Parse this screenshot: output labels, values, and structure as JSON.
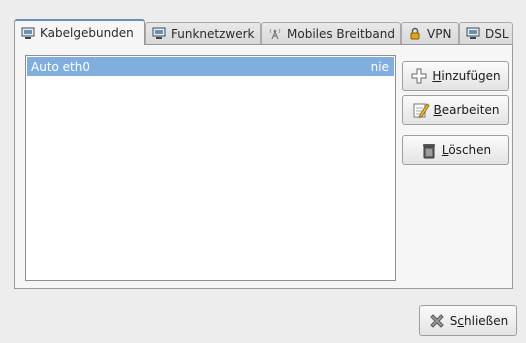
{
  "tabs": [
    {
      "label": "Kabelgebunden",
      "icon": "network-wired-icon",
      "active": true
    },
    {
      "label": "Funknetzwerk",
      "icon": "network-wireless-icon",
      "active": false
    },
    {
      "label": "Mobiles Breitband",
      "icon": "antenna-icon",
      "active": false
    },
    {
      "label": "VPN",
      "icon": "lock-icon",
      "active": false
    },
    {
      "label": "DSL",
      "icon": "network-dsl-icon",
      "active": false
    }
  ],
  "connections": [
    {
      "name": "Auto eth0",
      "last_used": "nie",
      "selected": true
    }
  ],
  "buttons": {
    "add": {
      "mnemonic": "H",
      "rest": "inzufügen"
    },
    "edit": {
      "mnemonic": "B",
      "rest": "earbeiten"
    },
    "delete": {
      "mnemonic": "L",
      "rest": "öschen"
    },
    "close": {
      "before": "S",
      "mnemonic": "c",
      "rest": "hließen"
    }
  },
  "colors": {
    "selection": "#7faedf",
    "active_tab_indicator": "#6b8fb8",
    "window_background": "#ededed"
  }
}
